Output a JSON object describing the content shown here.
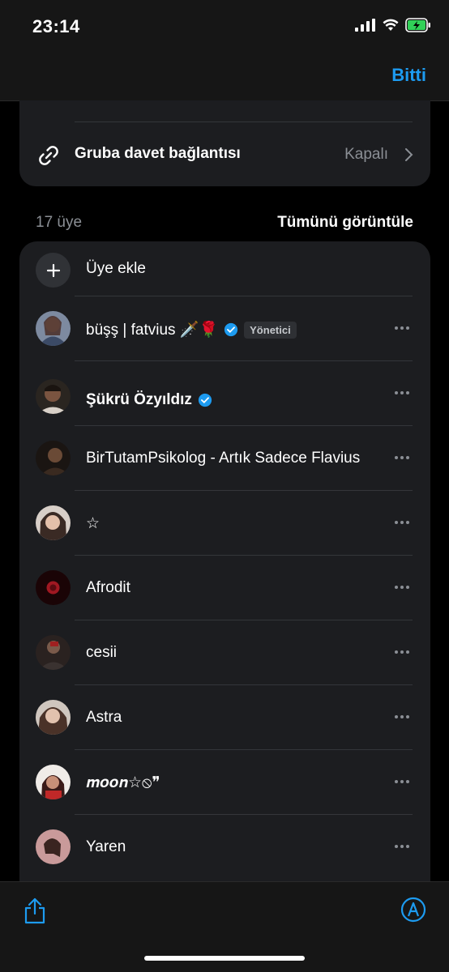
{
  "status": {
    "time": "23:14"
  },
  "nav": {
    "done_label": "Bitti"
  },
  "invite": {
    "label": "Gruba davet bağlantısı",
    "value": "Kapalı"
  },
  "members_header": {
    "count": "17 üye",
    "view_all": "Tümünü görüntüle"
  },
  "add_member": {
    "label": "Üye ekle"
  },
  "members": [
    {
      "name": "büşş | fatvius 🗡️🌹",
      "verified": true,
      "badge": "Yönetici",
      "bold": false,
      "avatar_color": "#5a6b86"
    },
    {
      "name": "Şükrü Özyıldız",
      "verified": true,
      "badge": "",
      "bold": true,
      "avatar_color": "#6b4e3d"
    },
    {
      "name": "BirTutamPsikolog - Artık Sadece Flavius",
      "verified": false,
      "badge": "",
      "bold": false,
      "avatar_color": "#3d2a20"
    },
    {
      "name": "☆",
      "verified": false,
      "badge": "",
      "bold": false,
      "avatar_color": "#b59a8a"
    },
    {
      "name": "Afrodit",
      "verified": false,
      "badge": "",
      "bold": false,
      "avatar_color": "#3a0a0e"
    },
    {
      "name": "cesii",
      "verified": false,
      "badge": "",
      "bold": false,
      "avatar_color": "#4a3a34"
    },
    {
      "name": "Astra",
      "verified": false,
      "badge": "",
      "bold": false,
      "avatar_color": "#8c7464"
    },
    {
      "name": "𝒎𝒐𝒐𝒏☆⦸❞",
      "verified": false,
      "badge": "",
      "bold": false,
      "avatar_color": "#5a2a2a"
    },
    {
      "name": "Yaren",
      "verified": false,
      "badge": "",
      "bold": false,
      "avatar_color": "#b88a8a"
    }
  ],
  "colors": {
    "accent": "#1d9bf0",
    "background": "#000000",
    "card": "#1c1d20"
  }
}
